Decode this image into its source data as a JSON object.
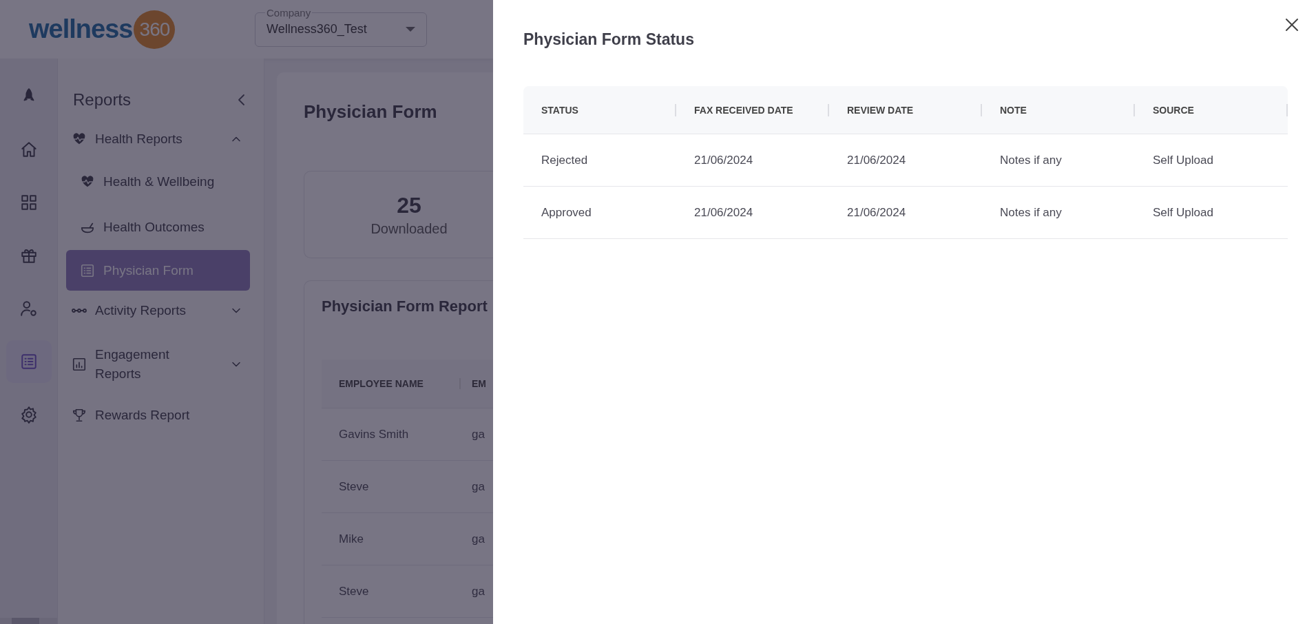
{
  "header": {
    "logo": {
      "word": "wellness",
      "badge": "360"
    },
    "company_field": {
      "label": "Company",
      "value": "Wellness360_Test"
    }
  },
  "rail": [
    {
      "kind": "rocket",
      "selected": false
    },
    {
      "kind": "home",
      "selected": false
    },
    {
      "kind": "grid",
      "selected": false
    },
    {
      "kind": "gift",
      "selected": false
    },
    {
      "kind": "user-gear",
      "selected": false
    },
    {
      "kind": "list",
      "selected": true
    },
    {
      "kind": "gear",
      "selected": false
    }
  ],
  "sidebar": {
    "title": "Reports",
    "items": [
      {
        "label": "Health Reports",
        "kind": "heart",
        "expanded": true,
        "selected": false,
        "children": [
          {
            "label": "Health & Wellbeing",
            "kind": "heart",
            "selected": false
          },
          {
            "label": "Health Outcomes",
            "kind": "bowl",
            "selected": false
          },
          {
            "label": "Physician Form",
            "kind": "list",
            "selected": true
          }
        ]
      },
      {
        "label": "Activity Reports",
        "kind": "dots",
        "expanded": false,
        "selected": false
      },
      {
        "label": "Engagement Reports",
        "kind": "chart",
        "expanded": false,
        "selected": false
      },
      {
        "label": "Rewards Report",
        "kind": "trophy",
        "selected": false
      }
    ]
  },
  "main": {
    "title": "Physician Form",
    "stat": {
      "value": "25",
      "label": "Downloaded"
    },
    "report": {
      "title": "Physician Form Report",
      "columns": [
        "EMPLOYEE NAME",
        "EM"
      ],
      "rows": [
        [
          "Gavins Smith",
          "ga"
        ],
        [
          "Steve",
          "ga"
        ],
        [
          "Mike",
          "ga"
        ],
        [
          "Steve",
          "ga"
        ]
      ]
    }
  },
  "drawer": {
    "title": "Physician Form Status",
    "table": {
      "columns": [
        "STATUS",
        "FAX RECEIVED DATE",
        "REVIEW DATE",
        "NOTE",
        "SOURCE"
      ],
      "rows": [
        [
          "Rejected",
          "21/06/2024",
          "21/06/2024",
          "Notes if any",
          "Self Upload"
        ],
        [
          "Approved",
          "21/06/2024",
          "21/06/2024",
          "Notes if any",
          "Self Upload"
        ]
      ]
    }
  }
}
